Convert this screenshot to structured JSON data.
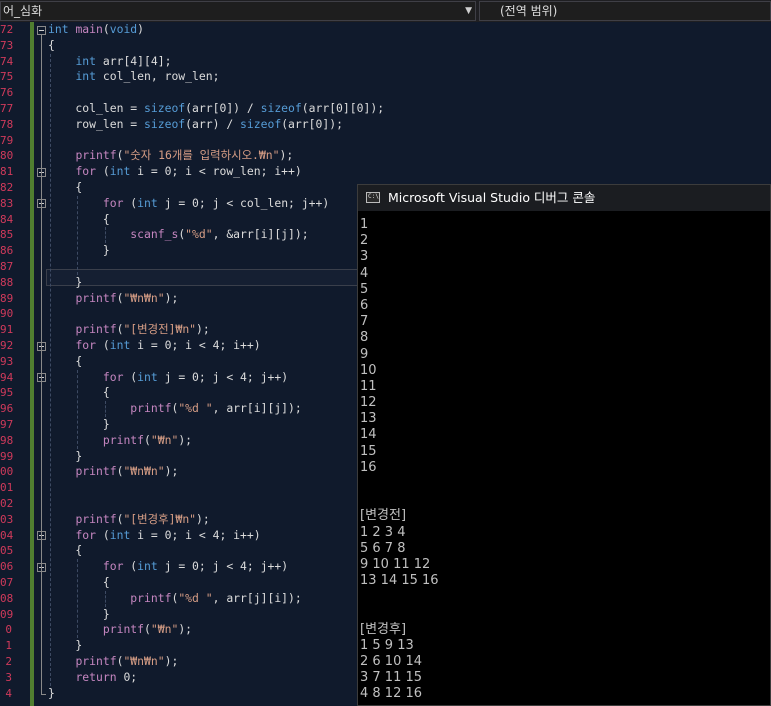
{
  "toolbar": {
    "scope_dropdown": "어_심화",
    "member_dropdown": "(전역 범위)"
  },
  "editor": {
    "line_numbers": [
      "72",
      "73",
      "74",
      "75",
      "76",
      "77",
      "78",
      "79",
      "80",
      "81",
      "82",
      "83",
      "84",
      "85",
      "86",
      "87",
      "88",
      "89",
      "90",
      "91",
      "92",
      "93",
      "94",
      "95",
      "96",
      "97",
      "98",
      "99",
      "00",
      "01",
      "02",
      "03",
      "04",
      "05",
      "06",
      "07",
      "08",
      "09",
      "0",
      "1",
      "2",
      "3",
      "4"
    ],
    "lines": [
      [
        {
          "t": "int",
          "c": "kw"
        },
        {
          "t": " "
        },
        {
          "t": "main",
          "c": "fn"
        },
        {
          "t": "("
        },
        {
          "t": "void",
          "c": "kw"
        },
        {
          "t": ")"
        }
      ],
      [
        {
          "t": "{"
        }
      ],
      [
        {
          "t": "    "
        },
        {
          "t": "int",
          "c": "kw"
        },
        {
          "t": " arr[4][4];"
        }
      ],
      [
        {
          "t": "    "
        },
        {
          "t": "int",
          "c": "kw"
        },
        {
          "t": " col_len, row_len;"
        }
      ],
      [],
      [
        {
          "t": "    col_len = "
        },
        {
          "t": "sizeof",
          "c": "kw"
        },
        {
          "t": "(arr[0]) / "
        },
        {
          "t": "sizeof",
          "c": "kw"
        },
        {
          "t": "(arr[0][0]);"
        }
      ],
      [
        {
          "t": "    row_len = "
        },
        {
          "t": "sizeof",
          "c": "kw"
        },
        {
          "t": "(arr) / "
        },
        {
          "t": "sizeof",
          "c": "kw"
        },
        {
          "t": "(arr[0]);"
        }
      ],
      [],
      [
        {
          "t": "    "
        },
        {
          "t": "printf",
          "c": "fn"
        },
        {
          "t": "("
        },
        {
          "t": "\"숫자 16개를 입력하시오.₩n\"",
          "c": "st"
        },
        {
          "t": ");"
        }
      ],
      [
        {
          "t": "    "
        },
        {
          "t": "for",
          "c": "fn"
        },
        {
          "t": " ("
        },
        {
          "t": "int",
          "c": "kw"
        },
        {
          "t": " i = 0; i < row_len; i++)"
        }
      ],
      [
        {
          "t": "    {"
        }
      ],
      [
        {
          "t": "        "
        },
        {
          "t": "for",
          "c": "fn"
        },
        {
          "t": " ("
        },
        {
          "t": "int",
          "c": "kw"
        },
        {
          "t": " j = 0; j < col_len; j++)"
        }
      ],
      [
        {
          "t": "        {"
        }
      ],
      [
        {
          "t": "            "
        },
        {
          "t": "scanf_s",
          "c": "fn"
        },
        {
          "t": "("
        },
        {
          "t": "\"%d\"",
          "c": "st"
        },
        {
          "t": ", &arr[i][j]);"
        }
      ],
      [
        {
          "t": "        }"
        }
      ],
      [],
      [
        {
          "t": "    }"
        }
      ],
      [
        {
          "t": "    "
        },
        {
          "t": "printf",
          "c": "fn"
        },
        {
          "t": "("
        },
        {
          "t": "\"₩n₩n\"",
          "c": "st"
        },
        {
          "t": ");"
        }
      ],
      [],
      [
        {
          "t": "    "
        },
        {
          "t": "printf",
          "c": "fn"
        },
        {
          "t": "("
        },
        {
          "t": "\"[변경전]₩n\"",
          "c": "st"
        },
        {
          "t": ");"
        }
      ],
      [
        {
          "t": "    "
        },
        {
          "t": "for",
          "c": "fn"
        },
        {
          "t": " ("
        },
        {
          "t": "int",
          "c": "kw"
        },
        {
          "t": " i = 0; i < 4; i++)"
        }
      ],
      [
        {
          "t": "    {"
        }
      ],
      [
        {
          "t": "        "
        },
        {
          "t": "for",
          "c": "fn"
        },
        {
          "t": " ("
        },
        {
          "t": "int",
          "c": "kw"
        },
        {
          "t": " j = 0; j < 4; j++)"
        }
      ],
      [
        {
          "t": "        {"
        }
      ],
      [
        {
          "t": "            "
        },
        {
          "t": "printf",
          "c": "fn"
        },
        {
          "t": "("
        },
        {
          "t": "\"%d \"",
          "c": "st"
        },
        {
          "t": ", arr[i][j]);"
        }
      ],
      [
        {
          "t": "        }"
        }
      ],
      [
        {
          "t": "        "
        },
        {
          "t": "printf",
          "c": "fn"
        },
        {
          "t": "("
        },
        {
          "t": "\"₩n\"",
          "c": "st"
        },
        {
          "t": ");"
        }
      ],
      [
        {
          "t": "    }"
        }
      ],
      [
        {
          "t": "    "
        },
        {
          "t": "printf",
          "c": "fn"
        },
        {
          "t": "("
        },
        {
          "t": "\"₩n₩n\"",
          "c": "st"
        },
        {
          "t": ");"
        }
      ],
      [],
      [],
      [
        {
          "t": "    "
        },
        {
          "t": "printf",
          "c": "fn"
        },
        {
          "t": "("
        },
        {
          "t": "\"[변경후]₩n\"",
          "c": "st"
        },
        {
          "t": ");"
        }
      ],
      [
        {
          "t": "    "
        },
        {
          "t": "for",
          "c": "fn"
        },
        {
          "t": " ("
        },
        {
          "t": "int",
          "c": "kw"
        },
        {
          "t": " i = 0; i < 4; i++)"
        }
      ],
      [
        {
          "t": "    {"
        }
      ],
      [
        {
          "t": "        "
        },
        {
          "t": "for",
          "c": "fn"
        },
        {
          "t": " ("
        },
        {
          "t": "int",
          "c": "kw"
        },
        {
          "t": " j = 0; j < 4; j++)"
        }
      ],
      [
        {
          "t": "        {"
        }
      ],
      [
        {
          "t": "            "
        },
        {
          "t": "printf",
          "c": "fn"
        },
        {
          "t": "("
        },
        {
          "t": "\"%d \"",
          "c": "st"
        },
        {
          "t": ", arr[j][i]);"
        }
      ],
      [
        {
          "t": "        }"
        }
      ],
      [
        {
          "t": "        "
        },
        {
          "t": "printf",
          "c": "fn"
        },
        {
          "t": "("
        },
        {
          "t": "\"₩n\"",
          "c": "st"
        },
        {
          "t": ");"
        }
      ],
      [
        {
          "t": "    }"
        }
      ],
      [
        {
          "t": "    "
        },
        {
          "t": "printf",
          "c": "fn"
        },
        {
          "t": "("
        },
        {
          "t": "\"₩n₩n\"",
          "c": "st"
        },
        {
          "t": ");"
        }
      ],
      [
        {
          "t": "    "
        },
        {
          "t": "return",
          "c": "fn"
        },
        {
          "t": " 0;"
        }
      ],
      [
        {
          "t": "}"
        }
      ]
    ],
    "fold_markers": [
      0,
      9,
      11,
      20,
      22,
      32,
      34
    ]
  },
  "console": {
    "title": "Microsoft Visual Studio 디버그 콘솔",
    "icon": "console-app-icon",
    "output": [
      "1",
      "2",
      "3",
      "4",
      "5",
      "6",
      "7",
      "8",
      "9",
      "10",
      "11",
      "12",
      "13",
      "14",
      "15",
      "16",
      "",
      "",
      "[변경전]",
      "1 2 3 4",
      "5 6 7 8",
      "9 10 11 12",
      "13 14 15 16",
      "",
      "",
      "[변경후]",
      "1 5 9 13",
      "2 6 10 14",
      "3 7 11 15",
      "4 8 12 16"
    ]
  },
  "colors": {
    "keyword": "#569cd6",
    "control": "#c586c0",
    "string": "#d69d85",
    "line_number": "#d03a5b",
    "change_bar": "#507e30",
    "editor_bg": "#101a2c"
  }
}
